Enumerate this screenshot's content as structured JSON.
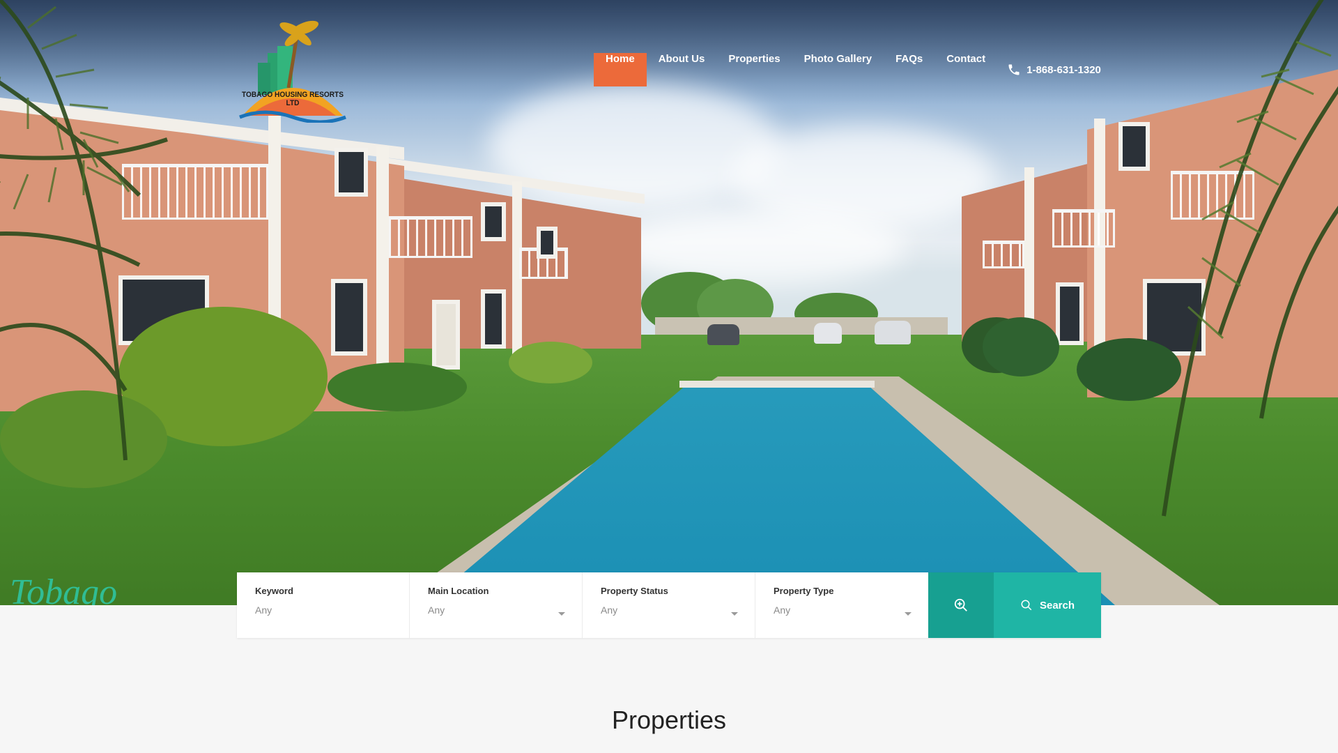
{
  "brand": {
    "logo_text": "TOBAGO HOUSING RESORTS LTD",
    "accent_color": "#ec6a3a",
    "teal_color": "#1fb5a5"
  },
  "nav": {
    "items": [
      {
        "label": "Home",
        "active": true
      },
      {
        "label": "About Us",
        "active": false
      },
      {
        "label": "Properties",
        "active": false
      },
      {
        "label": "Photo Gallery",
        "active": false
      },
      {
        "label": "FAQs",
        "active": false
      },
      {
        "label": "Contact",
        "active": false
      }
    ],
    "phone": "1-868-631-1320",
    "phone_icon": "phone-icon"
  },
  "search": {
    "keyword": {
      "label": "Keyword",
      "placeholder": "Any"
    },
    "main_location": {
      "label": "Main Location",
      "value": "Any"
    },
    "property_status": {
      "label": "Property Status",
      "value": "Any"
    },
    "property_type": {
      "label": "Property Type",
      "value": "Any"
    },
    "advanced_icon": "zoom-in-icon",
    "button_label": "Search",
    "button_icon": "search-icon"
  },
  "section": {
    "title": "Properties"
  }
}
